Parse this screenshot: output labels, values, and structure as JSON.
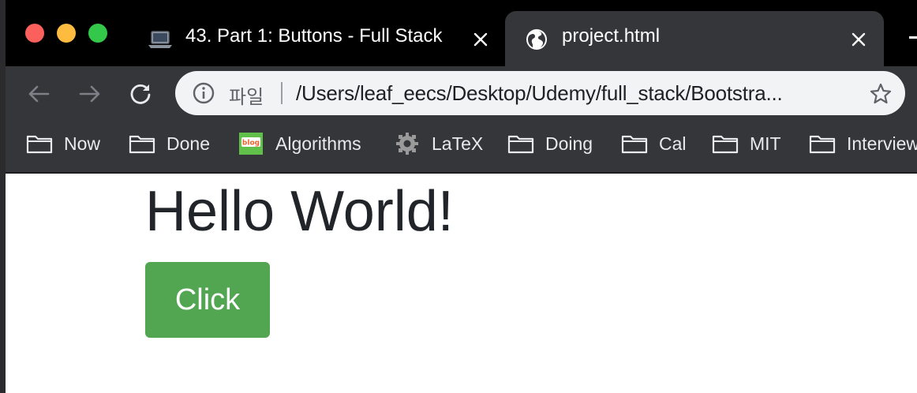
{
  "tabs": [
    {
      "title": "43. Part 1: Buttons - Full Stack",
      "icon": "laptop-icon",
      "active": false
    },
    {
      "title": "project.html",
      "icon": "globe-icon",
      "active": true
    }
  ],
  "toolbar": {
    "scheme_label": "파일",
    "url": "/Users/leaf_eecs/Desktop/Udemy/full_stack/Bootstra..."
  },
  "bookmarks": [
    {
      "label": "Now",
      "icon": "folder-icon"
    },
    {
      "label": "Done",
      "icon": "folder-icon"
    },
    {
      "label": "Algorithms",
      "icon": "blog-favicon-icon"
    },
    {
      "label": "LaTeX",
      "icon": "gear-favicon-icon"
    },
    {
      "label": "Doing",
      "icon": "folder-icon"
    },
    {
      "label": "Cal",
      "icon": "folder-icon"
    },
    {
      "label": "MIT",
      "icon": "folder-icon"
    },
    {
      "label": "Interview",
      "icon": "folder-icon"
    }
  ],
  "page": {
    "heading": "Hello World!",
    "button_label": "Click"
  },
  "colors": {
    "tabstrip": "#000000",
    "toolbar": "#35363a",
    "button_green": "#52a652",
    "heading_text": "#212529"
  }
}
